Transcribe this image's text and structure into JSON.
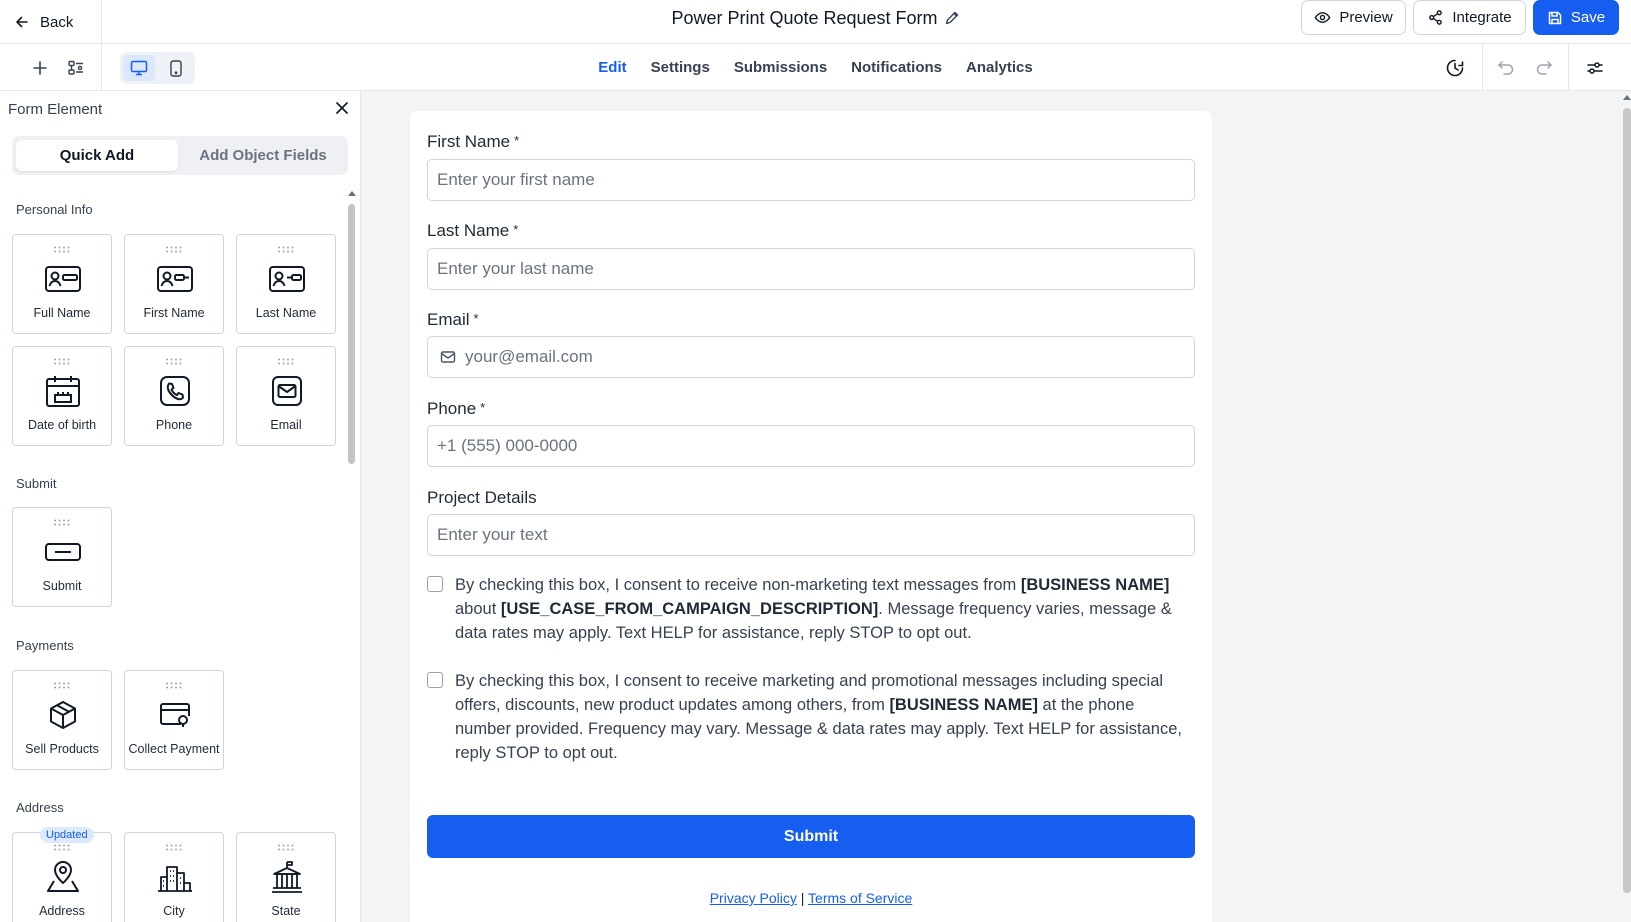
{
  "header": {
    "back_label": "Back",
    "form_title": "Power Print Quote Request Form",
    "preview_label": "Preview",
    "integrate_label": "Integrate",
    "save_label": "Save"
  },
  "tabs": [
    {
      "label": "Edit",
      "active": true
    },
    {
      "label": "Settings",
      "active": false
    },
    {
      "label": "Submissions",
      "active": false
    },
    {
      "label": "Notifications",
      "active": false
    },
    {
      "label": "Analytics",
      "active": false
    }
  ],
  "panel": {
    "title": "Form Element",
    "segments": [
      "Quick Add",
      "Add Object Fields"
    ],
    "sections": {
      "personal": {
        "label": "Personal Info",
        "items": [
          "Full Name",
          "First Name",
          "Last Name",
          "Date of birth",
          "Phone",
          "Email"
        ]
      },
      "submit": {
        "label": "Submit",
        "items": [
          "Submit"
        ]
      },
      "payments": {
        "label": "Payments",
        "items": [
          "Sell Products",
          "Collect Payment"
        ]
      },
      "address": {
        "label": "Address",
        "items": [
          "Address",
          "City",
          "State"
        ],
        "badge": "Updated"
      }
    }
  },
  "form": {
    "fields": [
      {
        "label": "First Name",
        "required": "*",
        "placeholder": "Enter your first name"
      },
      {
        "label": "Last Name",
        "required": "*",
        "placeholder": "Enter your last name"
      },
      {
        "label": "Email",
        "required": "*",
        "placeholder": "your@email.com"
      },
      {
        "label": "Phone",
        "required": "*",
        "placeholder": "+1 (555) 000-0000"
      },
      {
        "label": "Project Details",
        "required": "",
        "placeholder": "Enter your text"
      }
    ],
    "consent1": {
      "t1": "By checking this box, I consent to receive non-marketing text messages from ",
      "b1": "[BUSINESS NAME]",
      "t2": " about ",
      "b2": "[USE_CASE_FROM_CAMPAIGN_DESCRIPTION]",
      "t3": ". Message frequency varies, message & data rates may apply. Text HELP for assistance, reply STOP to opt out."
    },
    "consent2": {
      "t1": "By checking this box, I consent to receive marketing and promotional messages including special offers, discounts, new product updates among others, from ",
      "b1": "[BUSINESS NAME]",
      "t2": " at the phone number provided. Frequency may vary. Message & data rates may apply. Text HELP for assistance, reply STOP to opt out."
    },
    "submit_label": "Submit",
    "privacy_label": "Privacy Policy",
    "separator": "|",
    "terms_label": "Terms of Service"
  },
  "colors": {
    "accent": "#155eef",
    "border": "#d1d5db",
    "text": "#1f2937"
  }
}
